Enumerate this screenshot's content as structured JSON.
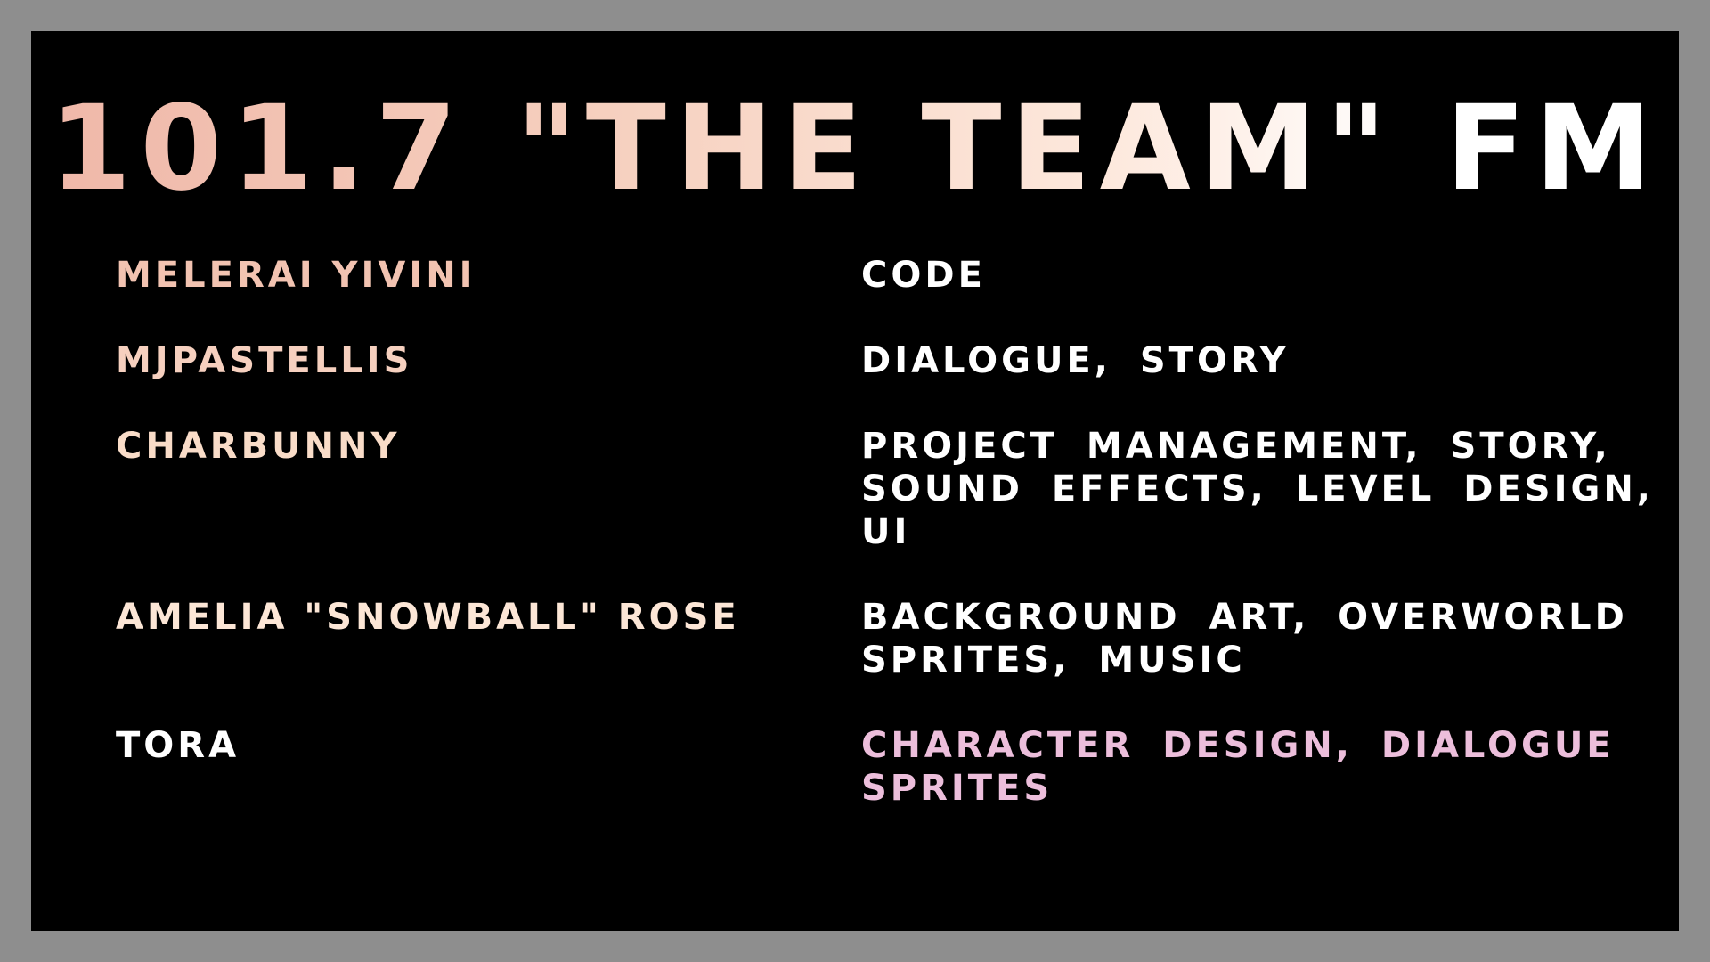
{
  "title": "101.7 \"THE TEAM\" FM",
  "credits": [
    {
      "name": "MELERAI YIVINI",
      "role": "CODE"
    },
    {
      "name": "MJPASTELLIS",
      "role": "DIALOGUE, STORY"
    },
    {
      "name": "CHARBUNNY",
      "role": "PROJECT MANAGEMENT, STORY, SOUND EFFECTS, LEVEL DESIGN, UI"
    },
    {
      "name": "AMELIA \"SNOWBALL\" ROSE",
      "role": "BACKGROUND ART, OVERWORLD SPRITES, MUSIC"
    },
    {
      "name": "TORA",
      "role": "CHARACTER DESIGN, DIALOGUE SPRITES"
    }
  ],
  "colors": {
    "frame": "#8e8e8e",
    "background": "#000000",
    "title_gradient_start": "#efb7a8",
    "title_gradient_end": "#ffffff",
    "name_peach": "#f2c3b1",
    "role_white": "#ffffff",
    "role_pink": "#ecbedb"
  }
}
